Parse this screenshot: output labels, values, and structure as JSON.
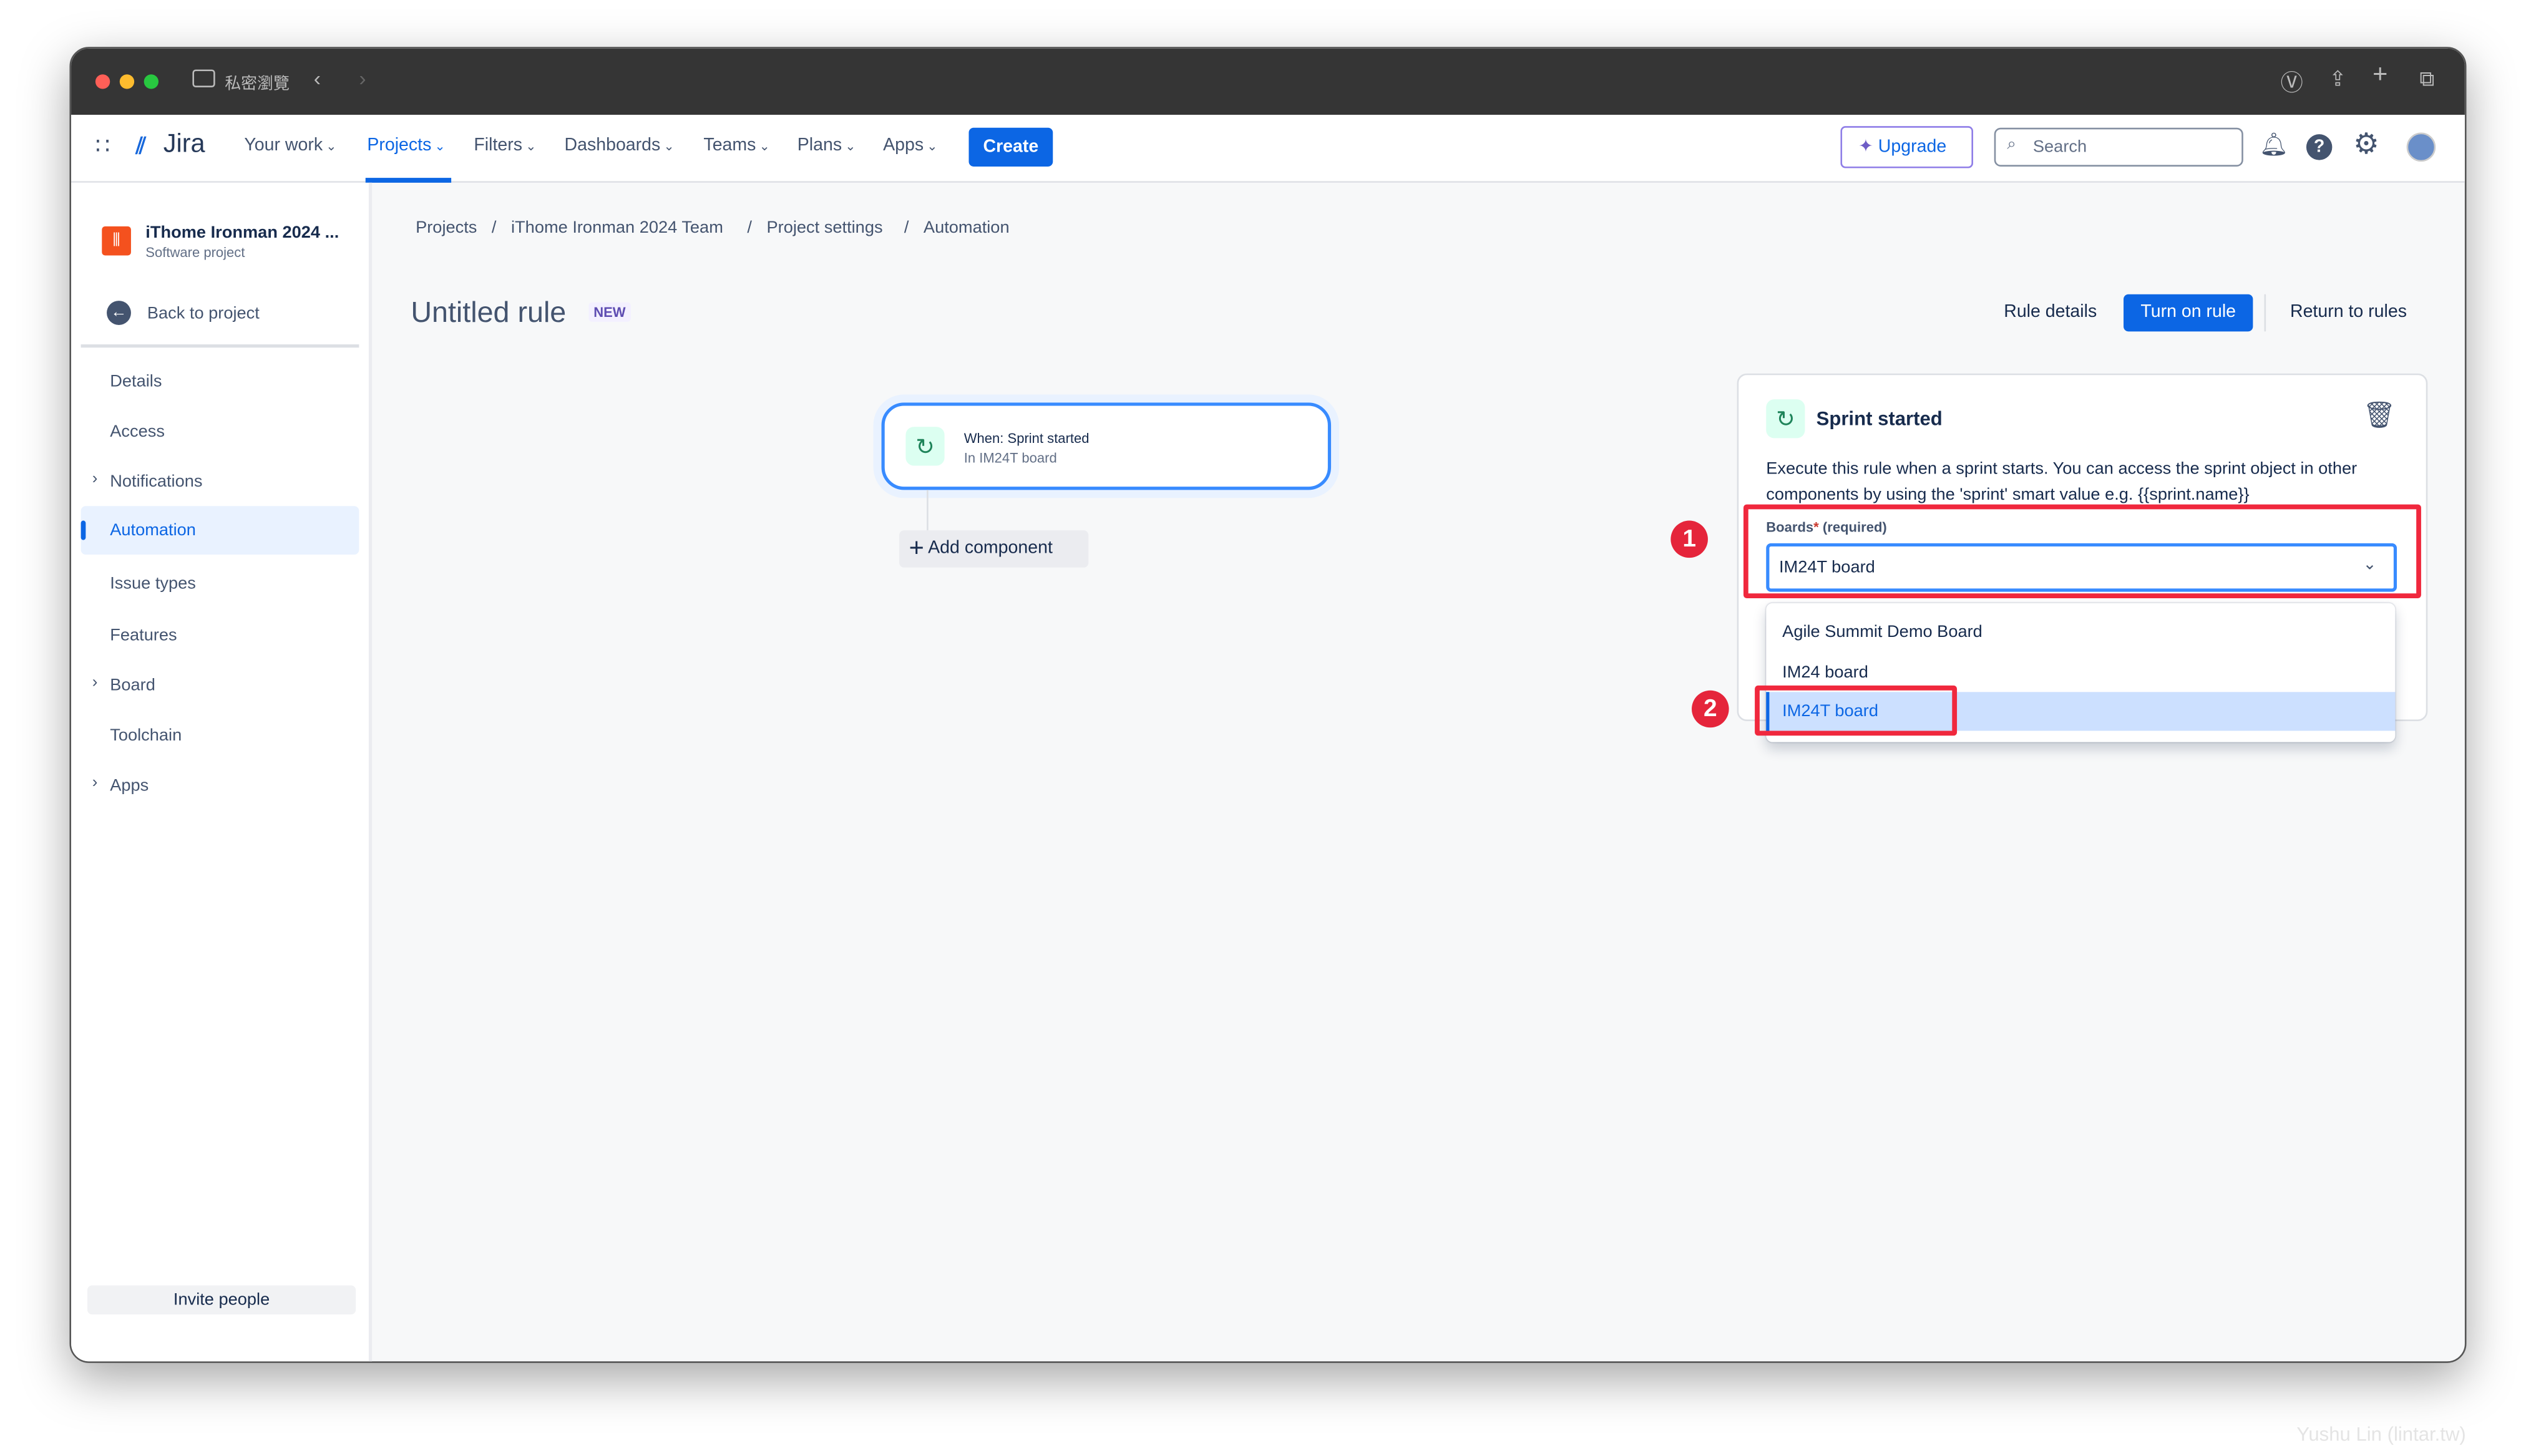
{
  "browser": {
    "tab_label": "私密瀏覽",
    "colors": {
      "close": "#ff5f57",
      "minimize": "#febc2e",
      "zoom": "#28c840"
    }
  },
  "nav": {
    "logo": "Jira",
    "items": [
      {
        "label": "Your work"
      },
      {
        "label": "Projects",
        "active": true
      },
      {
        "label": "Filters"
      },
      {
        "label": "Dashboards"
      },
      {
        "label": "Teams"
      },
      {
        "label": "Plans"
      },
      {
        "label": "Apps"
      }
    ],
    "create": "Create",
    "upgrade": "Upgrade",
    "search_placeholder": "Search"
  },
  "sidebar": {
    "project_name": "iThome Ironman 2024 ...",
    "project_type": "Software project",
    "back": "Back to project",
    "items": [
      {
        "label": "Details"
      },
      {
        "label": "Access"
      },
      {
        "label": "Notifications",
        "expandable": true
      },
      {
        "label": "Automation",
        "active": true
      },
      {
        "label": "Issue types"
      },
      {
        "label": "Features"
      },
      {
        "label": "Board",
        "expandable": true
      },
      {
        "label": "Toolchain"
      },
      {
        "label": "Apps",
        "expandable": true
      }
    ],
    "invite": "Invite people"
  },
  "breadcrumb": [
    "Projects",
    "iThome Ironman 2024 Team",
    "Project settings",
    "Automation"
  ],
  "rule": {
    "title": "Untitled rule",
    "badge": "NEW",
    "rule_details": "Rule details",
    "turn_on": "Turn on rule",
    "return": "Return to rules"
  },
  "trigger_card": {
    "title": "When: Sprint started",
    "subtitle": "In IM24T board",
    "add_component": "Add component"
  },
  "panel": {
    "title": "Sprint started",
    "description": "Execute this rule when a sprint starts. You can access the sprint object in other components by using the 'sprint' smart value e.g. {{sprint.name}}",
    "field_label": "Boards",
    "required_mark": "*",
    "required_text": "(required)",
    "selected": "IM24T board",
    "options": [
      {
        "label": "Agile Summit Demo Board"
      },
      {
        "label": "IM24 board"
      },
      {
        "label": "IM24T board",
        "selected": true
      }
    ]
  },
  "annotations": [
    "1",
    "2"
  ],
  "watermark": "Yushu Lin (lintar.tw)",
  "colors": {
    "accent": "#0c66e4",
    "annotation": "#f0283d",
    "selected_bg": "#cce0ff"
  }
}
